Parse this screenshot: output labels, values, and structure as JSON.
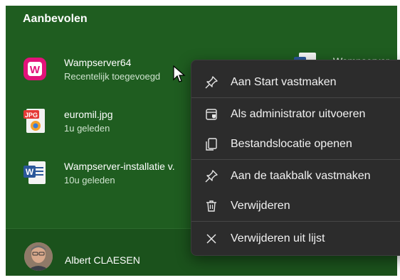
{
  "section": {
    "title": "Aanbevolen"
  },
  "recommended": [
    {
      "name": "Wampserver64",
      "detail": "Recentelijk toegevoegd",
      "icon": "wampserver-icon"
    },
    {
      "name": "euromil.jpg",
      "detail": "1u geleden",
      "icon": "jpg-file-icon"
    },
    {
      "name": "Wampserver-installatie v.",
      "detail": "10u geleden",
      "icon": "word-doc-icon"
    }
  ],
  "recommended_right": {
    "name": "Wampserver-",
    "icon": "word-doc-icon"
  },
  "user": {
    "name": "Albert CLAESEN"
  },
  "context_menu": {
    "items": [
      {
        "label": "Aan Start vastmaken",
        "icon": "pin-icon"
      },
      {
        "label": "Als administrator uitvoeren",
        "icon": "shield-admin-icon"
      },
      {
        "label": "Bestandslocatie openen",
        "icon": "folder-file-icon"
      },
      {
        "label": "Aan de taakbalk vastmaken",
        "icon": "pin-icon"
      },
      {
        "label": "Verwijderen",
        "icon": "trash-icon"
      },
      {
        "label": "Verwijderen uit lijst",
        "icon": "close-icon"
      }
    ]
  }
}
